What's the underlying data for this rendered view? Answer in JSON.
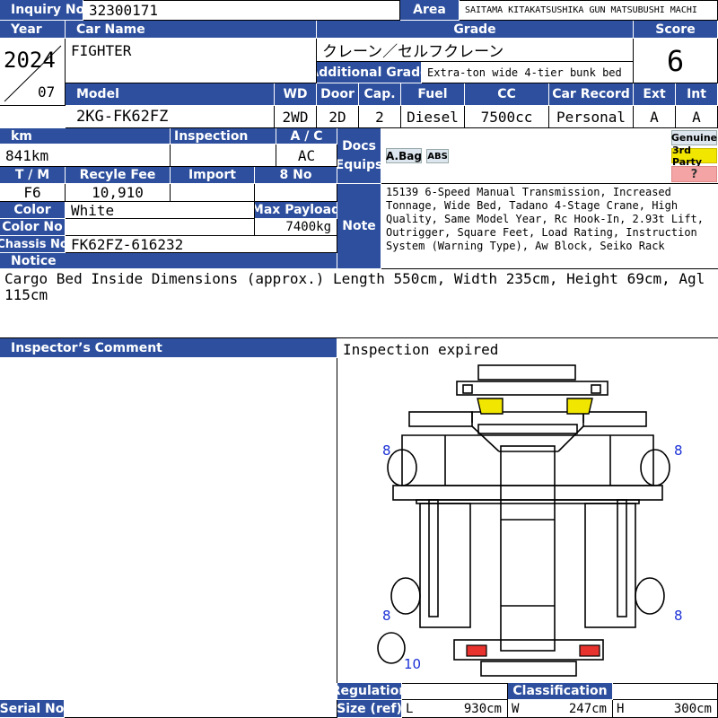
{
  "headers": {
    "inquiry_no": "Inquiry No",
    "area": "Area",
    "year": "Year",
    "car_name": "Car Name",
    "grade": "Grade",
    "score": "Score",
    "additional_grade": "Additional Grade",
    "model": "Model",
    "wd": "WD",
    "door": "Door",
    "cap": "Cap.",
    "fuel": "Fuel",
    "cc": "CC",
    "car_record": "Car Record",
    "ext": "Ext",
    "int": "Int",
    "km": "km",
    "inspection": "Inspection",
    "ac": "A / C",
    "docs": "Docs",
    "equips": "Equips",
    "tm": "T / M",
    "recycle_fee": "Recyle Fee",
    "import": "Import",
    "eight_no": "8 No",
    "color": "Color",
    "max_payload": "Max Payload",
    "color_no": "Color No",
    "chassis_no": "Chassis No",
    "note": "Note",
    "notice": "Notice",
    "inspectors_comment": "Inspector’s Comment",
    "regulation": "Regulation",
    "classification": "Classification",
    "size_ref": "Size (ref)",
    "serial_no": "Serial No"
  },
  "values": {
    "inquiry_no": "32300171",
    "area": "SAITAMA KITAKATSUSHIKA GUN MATSUBUSHI MACHI",
    "year": "2024",
    "month": "07",
    "car_name": "FIGHTER",
    "grade": "クレーン／セルフクレーン",
    "score": "6",
    "additional_grade": "Extra-ton wide 4-tier bunk bed",
    "model": "2KG-FK62FZ",
    "wd": "2WD",
    "door": "2D",
    "cap": "2",
    "fuel": "Diesel",
    "cc": "7500cc",
    "car_record": "Personal",
    "ext": "A",
    "int": "A",
    "km": "841km",
    "inspection": "",
    "ac": "AC",
    "tm": "F6",
    "recycle_fee": "10,910",
    "import": "",
    "eight_no": "",
    "color": "White",
    "max_payload": "7400kg",
    "color_no": "",
    "chassis_no": "FK62FZ-616232",
    "note": "15139 6-Speed Manual Transmission, Increased Tonnage, Wide Bed, Tadano 4-Stage Crane, High Quality, Same Model Year, Rc Hook-In, 2.93t Lift, Outrigger, Square Feet, Load Rating, Instruction System (Warning Type), Aw Block, Seiko Rack",
    "notice": "Cargo Bed Inside Dimensions (approx.) Length 550cm, Width 235cm, Height 69cm, Agl 115cm",
    "inspection_status": "Inspection expired",
    "size_l_label": "L",
    "size_l": "930cm",
    "size_w_label": "W",
    "size_w": "247cm",
    "size_h_label": "H",
    "size_h": "300cm"
  },
  "badges": {
    "abag": "A.Bag",
    "abs": "ABS",
    "genuine": "Genuine",
    "third_party": "3rd Party",
    "unknown": "?"
  },
  "tires": {
    "front_left": "8",
    "front_right": "8",
    "rear_left": "8",
    "rear_right": "8",
    "spare": "10"
  },
  "colors": {
    "header": "#2d4f9e",
    "marker": "#f1e600",
    "tail_light": "#e8322e",
    "genuine": "#dde6ee",
    "third_party": "#f1e600",
    "unknown": "#f4a4a4",
    "tire_number": "#1a2fd6"
  }
}
